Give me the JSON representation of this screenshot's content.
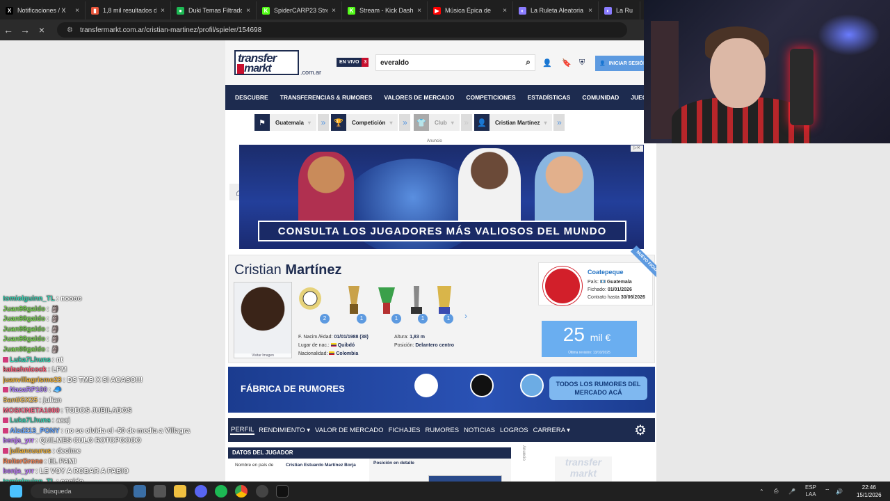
{
  "browser": {
    "tabs": [
      {
        "label": "Notificaciones / X",
        "fav": "X",
        "color": "#000000"
      },
      {
        "label": "1,8 mil resultados de",
        "fav": "▮",
        "color": "#e8553a"
      },
      {
        "label": "Duki Temas Filtrados",
        "fav": "●",
        "color": "#1db954"
      },
      {
        "label": "SpiderCARP23 Stream",
        "fav": "K",
        "color": "#53fc18"
      },
      {
        "label": "Stream - Kick Dashbo",
        "fav": "K",
        "color": "#53fc18"
      },
      {
        "label": "Música Épica de",
        "fav": "▶",
        "color": "#ff0000"
      },
      {
        "label": "La Ruleta Aleatoria",
        "fav": "◐",
        "color": "#8a7cff"
      },
      {
        "label": "La Ru",
        "fav": "◐",
        "color": "#8a7cff"
      }
    ],
    "url": "transfermarkt.com.ar/cristian-martinez/profil/spieler/154698"
  },
  "chat": [
    {
      "user": "tomiolguinn_TL",
      "text": "noooo",
      "color": "#3ad1b3",
      "badge": false
    },
    {
      "user": "Juan98galdo",
      "text": "🗿",
      "color": "#7ed957",
      "badge": false
    },
    {
      "user": "Juan98galdo",
      "text": "🗿",
      "color": "#7ed957",
      "badge": false
    },
    {
      "user": "Juan98galdo",
      "text": "🗿",
      "color": "#7ed957",
      "badge": false
    },
    {
      "user": "Juan98galdo",
      "text": "🗿",
      "color": "#7ed957",
      "badge": false
    },
    {
      "user": "Juan98galdo",
      "text": "🗿",
      "color": "#7ed957",
      "badge": false
    },
    {
      "user": "Luka7Lhuns",
      "text": "nt",
      "color": "#3ad1b3",
      "badge": true
    },
    {
      "user": "kalashnicock",
      "text": "LPM",
      "color": "#ff5f7a",
      "badge": false
    },
    {
      "user": "juanvillagrismo23",
      "text": "DS TMB X SI ACASO!!!",
      "color": "#f0b43c",
      "badge": false
    },
    {
      "user": "NazaRP100",
      "text": "🧢",
      "color": "#b58cff",
      "badge": true
    },
    {
      "user": "SantiGX25",
      "text": "julian",
      "color": "#f0c060",
      "badge": false
    },
    {
      "user": "MOSKINETA1000",
      "text": "TODOS JUBILADOS",
      "color": "#ff6a8a",
      "badge": false
    },
    {
      "user": "Luka7Lhuns",
      "text": "aaaj",
      "color": "#3ad1b3",
      "badge": true
    },
    {
      "user": "Alzd213_PONY",
      "text": "no se olvida el -50 de media a Villagra",
      "color": "#6aa8ff",
      "badge": true
    },
    {
      "user": "benja_yrr",
      "text": "QUILMES CULO ROTOPOOOO",
      "color": "#c07cff",
      "badge": false
    },
    {
      "user": "juliancuurus",
      "text": "decime",
      "color": "#f0b43c",
      "badge": true
    },
    {
      "user": "ReiterGrone",
      "text": "EL PAMI",
      "color": "#ff8a5a",
      "badge": false
    },
    {
      "user": "benja_yrr",
      "text": "LE VOY A ROBAR A FABIO",
      "color": "#c07cff",
      "badge": false
    },
    {
      "user": "tomiolguinn_TL",
      "text": "cogido.",
      "color": "#3ad1b3",
      "badge": false
    },
    {
      "user": "NazaRP100",
      "text": "",
      "color": "#b58cff",
      "badge": true
    }
  ],
  "site": {
    "logo_top": "transfer",
    "logo_bottom": "markt",
    "domain": ".com.ar",
    "live_label": "EN VIVO",
    "live_count": "3",
    "search_value": "everaldo",
    "login_label": "INICIAR SESIÓN",
    "nav": [
      "DESCUBRE",
      "TRANSFERENCIAS & RUMORES",
      "VALORES DE MERCADO",
      "COMPETICIONES",
      "ESTADÍSTICAS",
      "COMUNIDAD",
      "JUEGOS"
    ],
    "breadcrumbs": [
      "Guatemala",
      "Competición",
      "Club",
      "Cristian Martínez"
    ],
    "ad_label": "Anuncio",
    "banner_text": "CONSULTA LOS JUGADORES MÁS VALIOSOS DEL MUNDO",
    "player": {
      "first_name": "Cristian",
      "last_name": "Martínez",
      "photo_credit": "Visitar Imagen",
      "trophies": [
        "2",
        "1",
        "1",
        "1",
        "1"
      ],
      "birth_label": "F. Nacim./Edad:",
      "birth_value": "01/01/1988 (38)",
      "place_label": "Lugar de nac.:",
      "place_value": "Quibdó",
      "nat_label": "Nacionalidad:",
      "nat_value": "Colombia",
      "height_label": "Altura:",
      "height_value": "1,83 m",
      "pos_label": "Posición:",
      "pos_value": "Delantero centro",
      "club_name": "Coatepeque",
      "club_country_label": "País:",
      "club_country": "Guatemala",
      "signed_label": "Fichado:",
      "signed_value": "01/01/2026",
      "contract_label": "Contrato hasta",
      "contract_value": "30/06/2026",
      "ribbon": "NUEVO FICHAJE",
      "value_number": "25",
      "value_unit": "mil €",
      "value_revision": "Última revisión: 13/10/2025"
    },
    "rumor_title": "FÁBRICA DE RUMORES",
    "rumor_button": "TODOS LOS RUMORES DEL MERCADO ACÁ",
    "subnav": [
      "PERFIL",
      "RENDIMIENTO ▾",
      "VALOR DE MERCADO",
      "FICHAJES",
      "RUMORES",
      "NOTICIAS",
      "LOGROS",
      "CARRERA ▾"
    ],
    "datos_title": "DATOS DEL JUGADOR",
    "datos_label": "Nombre en país de",
    "datos_value": "Cristian Estuardo Martínez Borja",
    "posicion_detalle": "Posición en detalle",
    "side_ad_label": "Anuncio",
    "side_ad_logo": "transfer markt"
  },
  "taskbar": {
    "search_label": "Búsqueda",
    "lang": "ESP",
    "lang2": "LAA",
    "time": "22:46",
    "date": "15/1/2026"
  }
}
